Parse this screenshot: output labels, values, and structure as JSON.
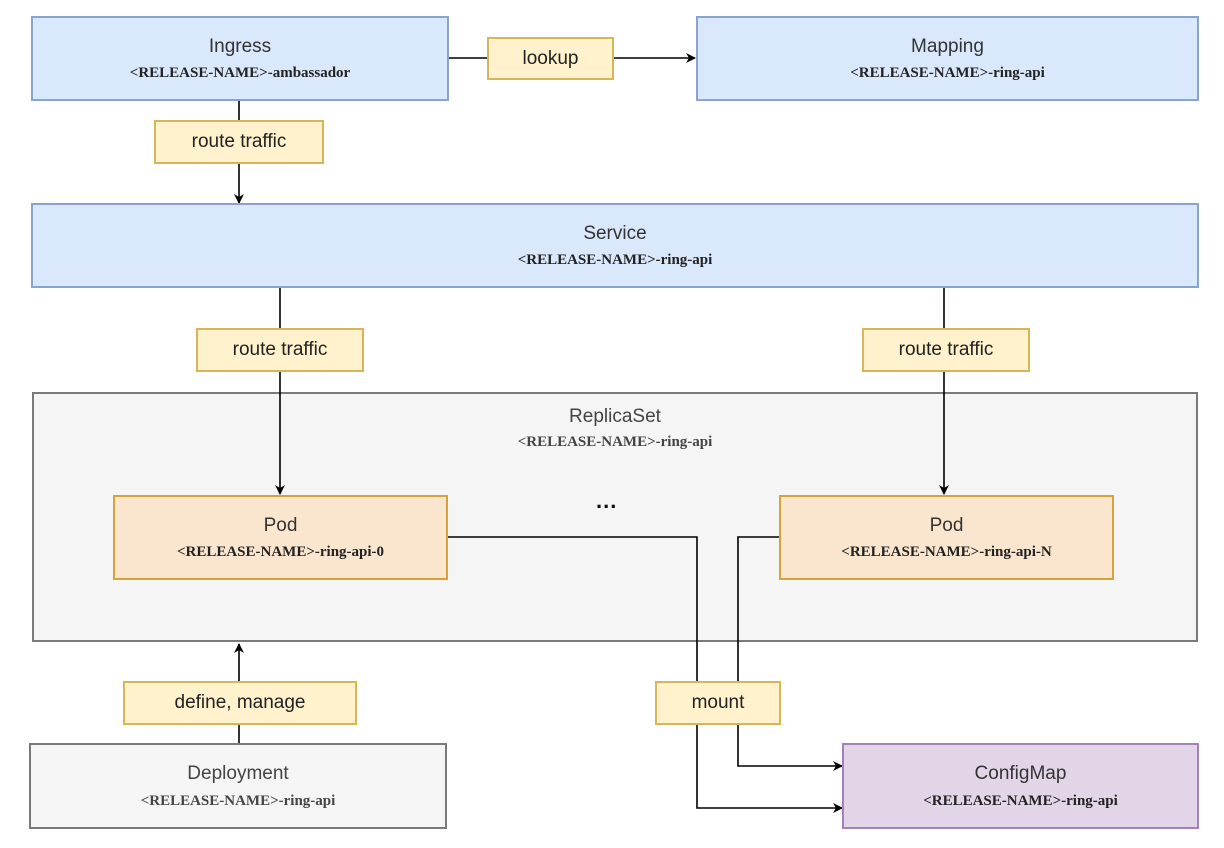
{
  "nodes": {
    "ingress": {
      "title": "Ingress",
      "name": "<RELEASE-NAME>-ambassador"
    },
    "mapping": {
      "title": "Mapping",
      "name": "<RELEASE-NAME>-ring-api"
    },
    "service": {
      "title": "Service",
      "name": "<RELEASE-NAME>-ring-api"
    },
    "replicaset": {
      "title": "ReplicaSet",
      "name": "<RELEASE-NAME>-ring-api"
    },
    "pod0": {
      "title": "Pod",
      "name": "<RELEASE-NAME>-ring-api-0"
    },
    "podN": {
      "title": "Pod",
      "name": "<RELEASE-NAME>-ring-api-N"
    },
    "ellipsis": "...",
    "deployment": {
      "title": "Deployment",
      "name": "<RELEASE-NAME>-ring-api"
    },
    "configmap": {
      "title": "ConfigMap",
      "name": "<RELEASE-NAME>-ring-api"
    }
  },
  "edges": {
    "lookup": "lookup",
    "ingress_to_service": "route traffic",
    "service_to_pod0": "route traffic",
    "service_to_podN": "route traffic",
    "define_manage": "define, manage",
    "mount": "mount"
  },
  "colors": {
    "blue_fill": "#dae8fc",
    "grey_fill": "#f5f5f5",
    "orange_fill": "#fae5cf",
    "purple_fill": "#e1d5e7",
    "label_fill": "#fff2cc"
  }
}
